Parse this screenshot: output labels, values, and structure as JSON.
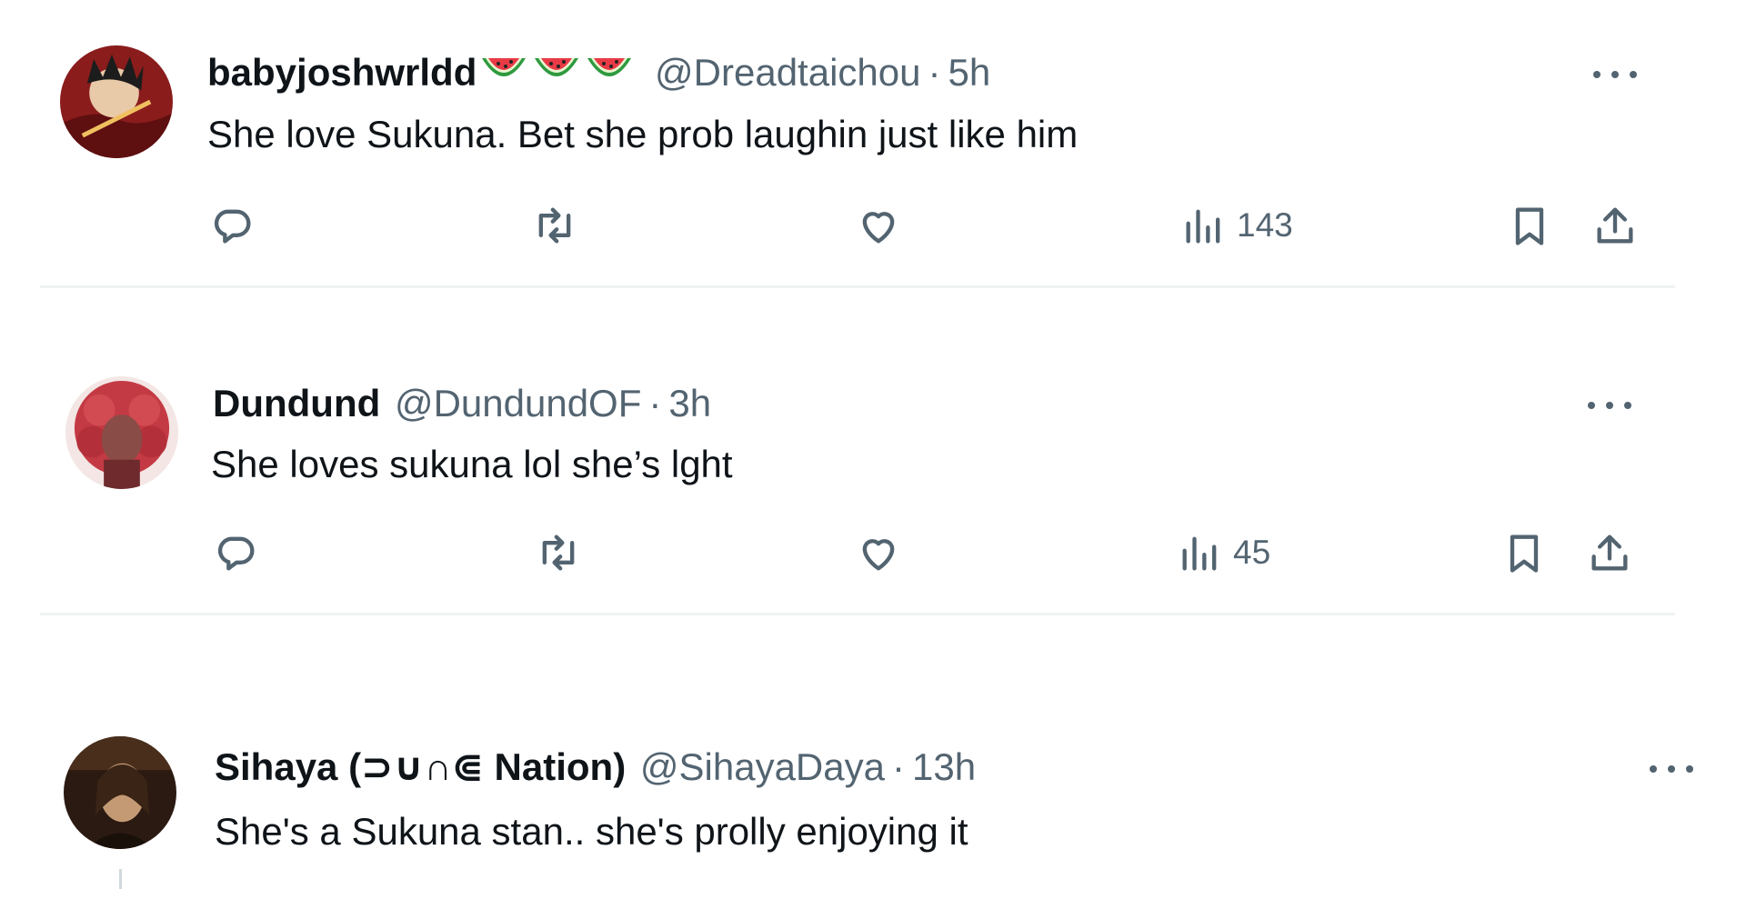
{
  "replies": [
    {
      "name": "babyjoshwrldd",
      "emoji": [
        "watermelon",
        "watermelon",
        "watermelon"
      ],
      "handle": "@Dreadtaichou",
      "time": "5h",
      "text": "She love Sukuna. Bet she prob laughin just like him",
      "views": "143"
    },
    {
      "name": "Dundund",
      "handle": "@DundundOF",
      "time": "3h",
      "text": "She loves sukuna lol she’s lght",
      "views": "45"
    },
    {
      "name": "Sihaya (⊃∪∩⋐ Nation)",
      "handle": "@SihayaDaya",
      "time": "13h",
      "text": "She's a Sukuna stan.. she's prolly enjoying it"
    }
  ],
  "separator": "·",
  "icons": {
    "reply": "reply-icon",
    "repost": "repost-icon",
    "like": "like-icon",
    "views": "views-icon",
    "bookmark": "bookmark-icon",
    "share": "share-icon",
    "more": "more-icon"
  }
}
